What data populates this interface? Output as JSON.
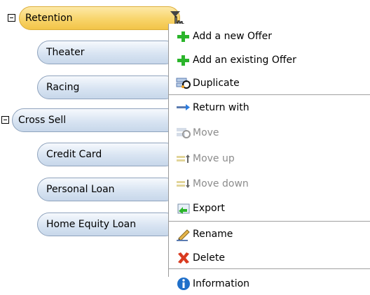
{
  "tree": [
    {
      "label": "Retention",
      "expanded": true,
      "selected": true,
      "children": [
        {
          "label": "Theater"
        },
        {
          "label": "Racing"
        }
      ]
    },
    {
      "label": "Cross Sell",
      "expanded": true,
      "children": [
        {
          "label": "Credit Card"
        },
        {
          "label": "Personal Loan"
        },
        {
          "label": "Home Equity Loan"
        }
      ]
    }
  ],
  "context_menu": {
    "items": [
      {
        "label": "Add a new Offer",
        "icon": "green-plus-icon",
        "enabled": true
      },
      {
        "label": "Add an existing Offer",
        "icon": "green-plus-icon",
        "enabled": true
      },
      {
        "label": "Duplicate",
        "icon": "duplicate-icon",
        "enabled": true
      },
      {
        "label": "Return with",
        "icon": "return-arrow-icon",
        "enabled": true
      },
      {
        "label": "Move",
        "icon": "move-icon",
        "enabled": false
      },
      {
        "label": "Move up",
        "icon": "move-up-icon",
        "enabled": false
      },
      {
        "label": "Move down",
        "icon": "move-down-icon",
        "enabled": false
      },
      {
        "label": "Export",
        "icon": "export-icon",
        "enabled": true
      },
      {
        "label": "Rename",
        "icon": "pencil-icon",
        "enabled": true
      },
      {
        "label": "Delete",
        "icon": "red-x-icon",
        "enabled": true
      },
      {
        "label": "Information",
        "icon": "info-icon",
        "enabled": true
      }
    ]
  },
  "colors": {
    "selected_node": "#f8d46a",
    "node": "#d8e4f2",
    "accent_green": "#2bb52b",
    "delete_red": "#d93a1f",
    "info_blue": "#1f6fc9"
  }
}
